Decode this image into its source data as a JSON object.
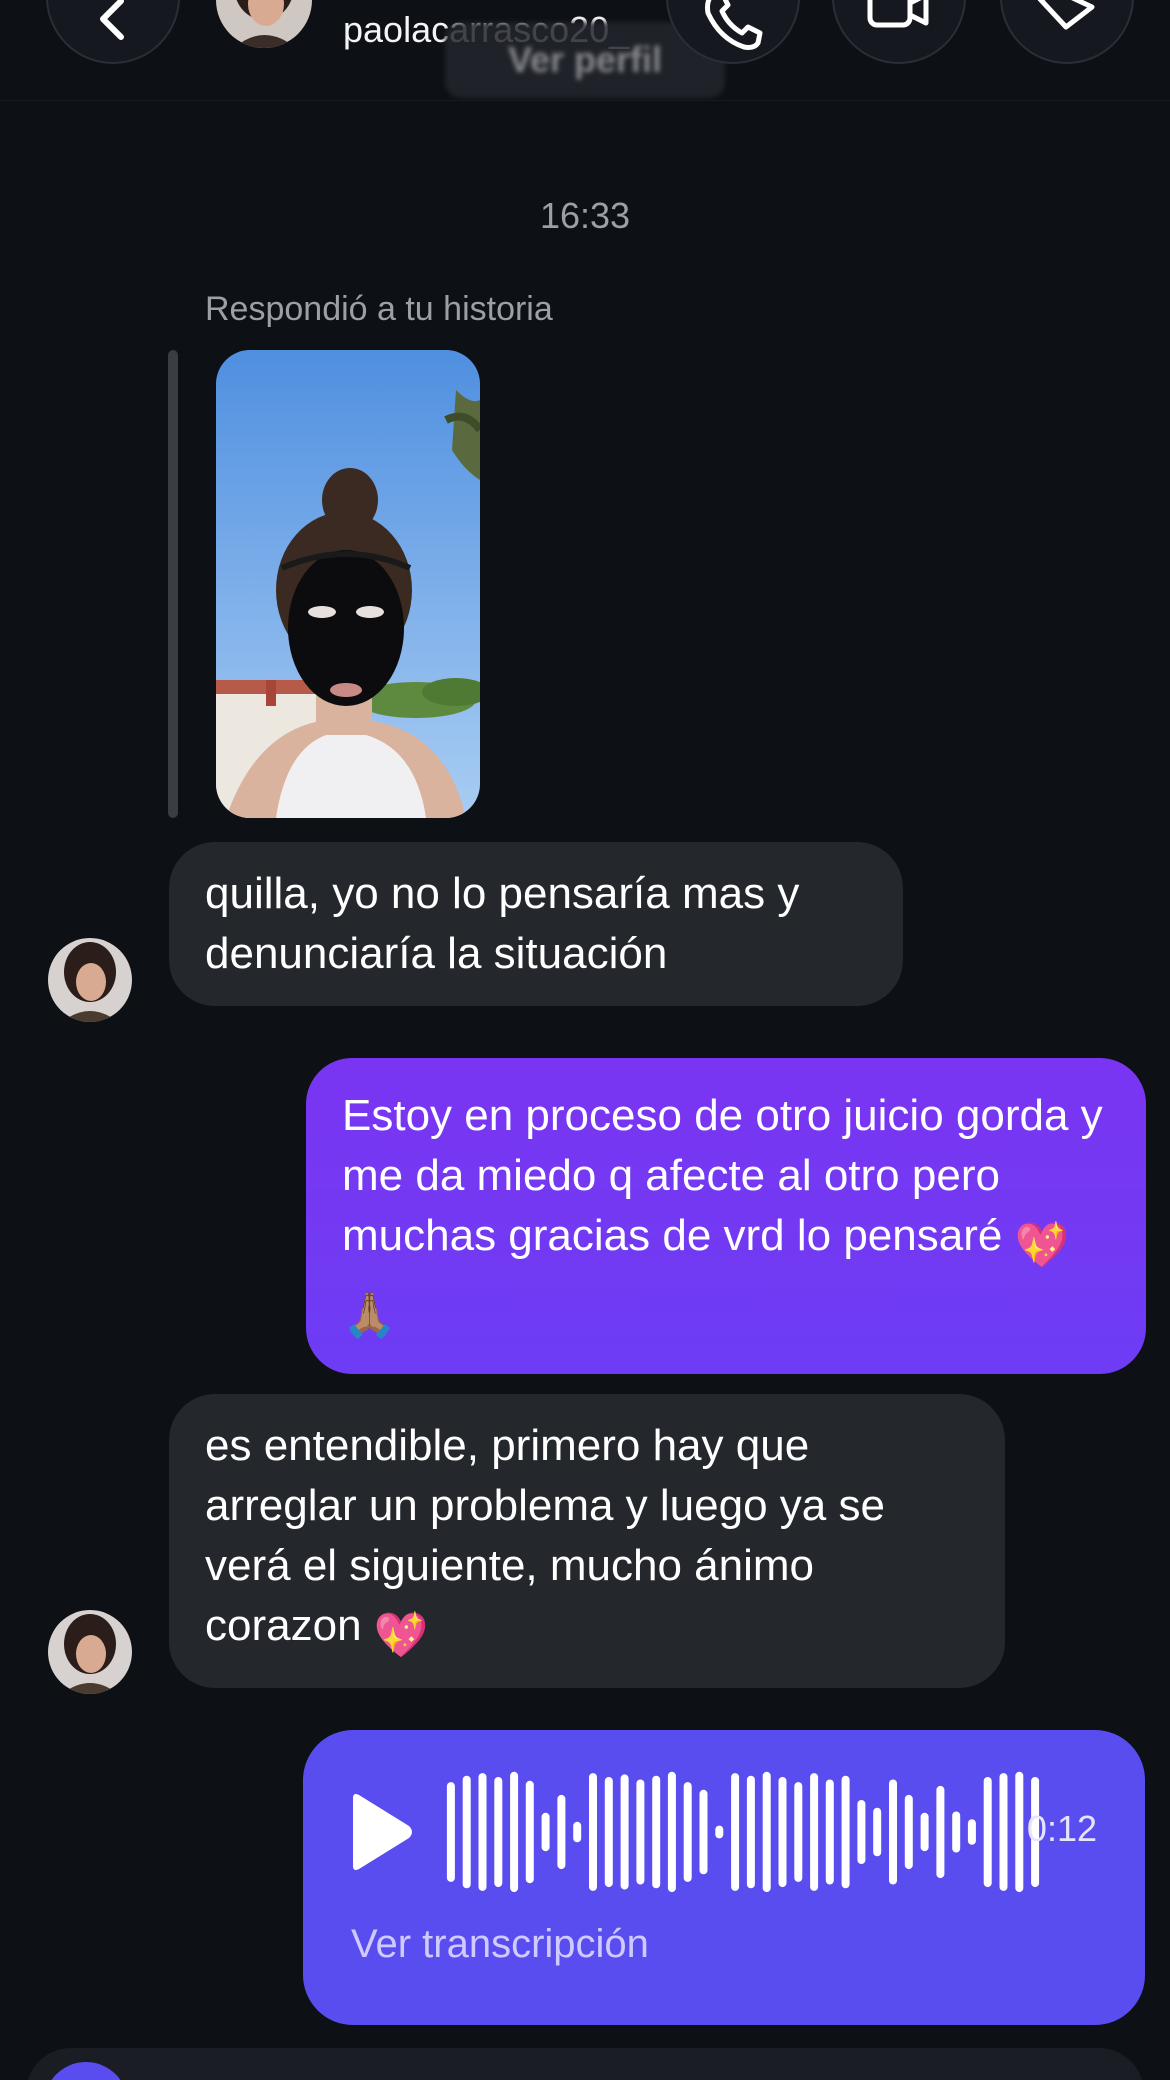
{
  "header": {
    "username": "paolacarrasco20_",
    "view_profile_label": "Ver perfil",
    "icons": {
      "back": "chevron-left-icon",
      "call": "phone-icon",
      "video": "video-camera-icon",
      "tag": "tag-icon"
    }
  },
  "thread": {
    "timestamp": "16:33",
    "story_reply_label": "Respondió a tu historia",
    "messages": [
      {
        "direction": "incoming",
        "text": "quilla, yo no lo pensaría mas y denunciaría la situación"
      },
      {
        "direction": "outgoing",
        "text": "Estoy en proceso de otro juicio gorda y me da miedo q afecte al otro pero muchas gracias de vrd lo pensaré",
        "emojis": [
          "💖",
          "🙏🏽"
        ]
      },
      {
        "direction": "incoming",
        "text": "es entendible, primero hay que arreglar un problema y luego ya se verá el siguiente, mucho ánimo corazon",
        "emojis": [
          "💖"
        ]
      }
    ],
    "voice_note": {
      "duration": "0:12",
      "transcript_label": "Ver transcripción",
      "waveform_levels": [
        0.78,
        0.88,
        0.92,
        0.86,
        0.94,
        0.8,
        0.3,
        0.58,
        0.16,
        0.92,
        0.86,
        0.9,
        0.82,
        0.88,
        0.94,
        0.78,
        0.66,
        0.1,
        0.92,
        0.88,
        0.94,
        0.86,
        0.78,
        0.92,
        0.82,
        0.88,
        0.5,
        0.38,
        0.82,
        0.58,
        0.3,
        0.72,
        0.32,
        0.2,
        0.86,
        0.92,
        0.94,
        0.86
      ]
    }
  },
  "colors": {
    "background": "#0d1015",
    "incoming_bubble": "#24272c",
    "outgoing_bubble": "#7236f3",
    "voice_bubble": "#5a4df0",
    "secondary_text": "#9c9fa6"
  }
}
